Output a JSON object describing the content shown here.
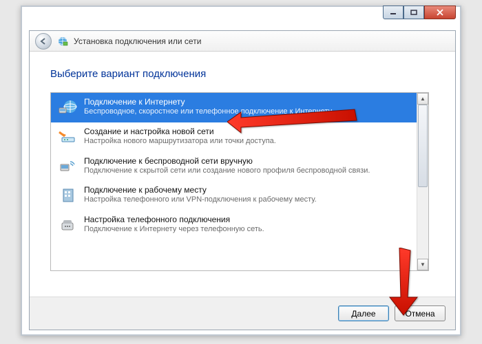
{
  "header": {
    "title": "Установка подключения или сети"
  },
  "body": {
    "title": "Выберите вариант подключения"
  },
  "options": [
    {
      "title": "Подключение к Интернету",
      "desc": "Беспроводное, скоростное или телефонное подключение к Интернету.",
      "selected": true
    },
    {
      "title": "Создание и настройка новой сети",
      "desc": "Настройка нового маршрутизатора или точки доступа."
    },
    {
      "title": "Подключение к беспроводной сети вручную",
      "desc": "Подключение к скрытой сети или создание нового профиля беспроводной связи."
    },
    {
      "title": "Подключение к рабочему месту",
      "desc": "Настройка телефонного или VPN-подключения к рабочему месту."
    },
    {
      "title": "Настройка телефонного подключения",
      "desc": "Подключение к Интернету через телефонную сеть."
    }
  ],
  "footer": {
    "next": "Далее",
    "cancel": "Отмена"
  },
  "titlebar": {
    "min": "__",
    "max": "☐",
    "close": "✕"
  }
}
